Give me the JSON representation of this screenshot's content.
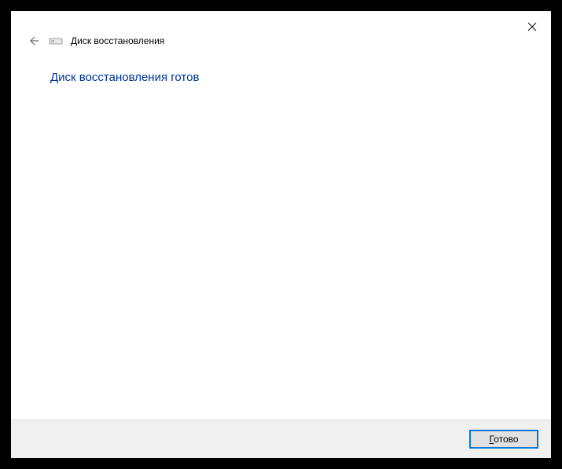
{
  "window": {
    "title": "Диск восстановления"
  },
  "content": {
    "heading": "Диск восстановления готов"
  },
  "footer": {
    "done_mnemonic": "Г",
    "done_rest": "отово"
  }
}
